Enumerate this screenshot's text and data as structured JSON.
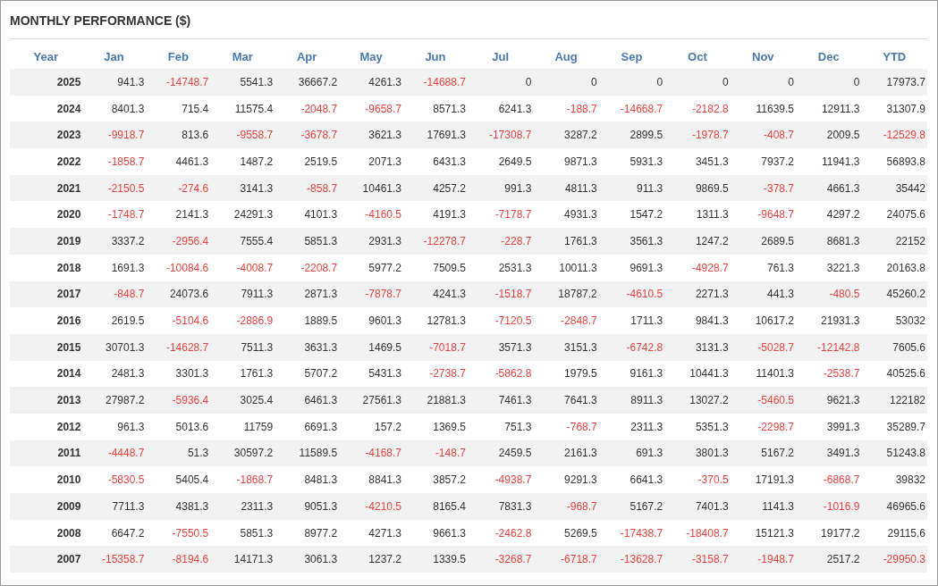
{
  "title": "MONTHLY PERFORMANCE ($)",
  "columns": [
    "Year",
    "Jan",
    "Feb",
    "Mar",
    "Apr",
    "May",
    "Jun",
    "Jul",
    "Aug",
    "Sep",
    "Oct",
    "Nov",
    "Dec",
    "YTD"
  ],
  "rows": [
    {
      "year": "2025",
      "cells": [
        {
          "text": "941.3",
          "negative": false
        },
        {
          "text": "-14748.7",
          "negative": true
        },
        {
          "text": "5541.3",
          "negative": false
        },
        {
          "text": "36667.2",
          "negative": false
        },
        {
          "text": "4261.3",
          "negative": false
        },
        {
          "text": "-14688.7",
          "negative": true
        },
        {
          "text": "0",
          "negative": false
        },
        {
          "text": "0",
          "negative": false
        },
        {
          "text": "0",
          "negative": false
        },
        {
          "text": "0",
          "negative": false
        },
        {
          "text": "0",
          "negative": false
        },
        {
          "text": "0",
          "negative": false
        },
        {
          "text": "17973.7",
          "negative": false
        }
      ]
    },
    {
      "year": "2024",
      "cells": [
        {
          "text": "8401.3",
          "negative": false
        },
        {
          "text": "715.4",
          "negative": false
        },
        {
          "text": "11575.4",
          "negative": false
        },
        {
          "text": "-2048.7",
          "negative": true
        },
        {
          "text": "-9658.7",
          "negative": true
        },
        {
          "text": "8571.3",
          "negative": false
        },
        {
          "text": "6241.3",
          "negative": false
        },
        {
          "text": "-188.7",
          "negative": true
        },
        {
          "text": "-14668.7",
          "negative": true
        },
        {
          "text": "-2182.8",
          "negative": true
        },
        {
          "text": "11639.5",
          "negative": false
        },
        {
          "text": "12911.3",
          "negative": false
        },
        {
          "text": "31307.9",
          "negative": false
        }
      ]
    },
    {
      "year": "2023",
      "cells": [
        {
          "text": "-9918.7",
          "negative": true
        },
        {
          "text": "813.6",
          "negative": false
        },
        {
          "text": "-9558.7",
          "negative": true
        },
        {
          "text": "-3678.7",
          "negative": true
        },
        {
          "text": "3621.3",
          "negative": false
        },
        {
          "text": "17691.3",
          "negative": false
        },
        {
          "text": "-17308.7",
          "negative": true
        },
        {
          "text": "3287.2",
          "negative": false
        },
        {
          "text": "2899.5",
          "negative": false
        },
        {
          "text": "-1978.7",
          "negative": true
        },
        {
          "text": "-408.7",
          "negative": true
        },
        {
          "text": "2009.5",
          "negative": false
        },
        {
          "text": "-12529.8",
          "negative": true
        }
      ]
    },
    {
      "year": "2022",
      "cells": [
        {
          "text": "-1858.7",
          "negative": true
        },
        {
          "text": "4461.3",
          "negative": false
        },
        {
          "text": "1487.2",
          "negative": false
        },
        {
          "text": "2519.5",
          "negative": false
        },
        {
          "text": "2071.3",
          "negative": false
        },
        {
          "text": "6431.3",
          "negative": false
        },
        {
          "text": "2649.5",
          "negative": false
        },
        {
          "text": "9871.3",
          "negative": false
        },
        {
          "text": "5931.3",
          "negative": false
        },
        {
          "text": "3451.3",
          "negative": false
        },
        {
          "text": "7937.2",
          "negative": false
        },
        {
          "text": "11941.3",
          "negative": false
        },
        {
          "text": "56893.8",
          "negative": false
        }
      ]
    },
    {
      "year": "2021",
      "cells": [
        {
          "text": "-2150.5",
          "negative": true
        },
        {
          "text": "-274.6",
          "negative": true
        },
        {
          "text": "3141.3",
          "negative": false
        },
        {
          "text": "-858.7",
          "negative": true
        },
        {
          "text": "10461.3",
          "negative": false
        },
        {
          "text": "4257.2",
          "negative": false
        },
        {
          "text": "991.3",
          "negative": false
        },
        {
          "text": "4811.3",
          "negative": false
        },
        {
          "text": "911.3",
          "negative": false
        },
        {
          "text": "9869.5",
          "negative": false
        },
        {
          "text": "-378.7",
          "negative": true
        },
        {
          "text": "4661.3",
          "negative": false
        },
        {
          "text": "35442",
          "negative": false
        }
      ]
    },
    {
      "year": "2020",
      "cells": [
        {
          "text": "-1748.7",
          "negative": true
        },
        {
          "text": "2141.3",
          "negative": false
        },
        {
          "text": "24291.3",
          "negative": false
        },
        {
          "text": "4101.3",
          "negative": false
        },
        {
          "text": "-4160.5",
          "negative": true
        },
        {
          "text": "4191.3",
          "negative": false
        },
        {
          "text": "-7178.7",
          "negative": true
        },
        {
          "text": "4931.3",
          "negative": false
        },
        {
          "text": "1547.2",
          "negative": false
        },
        {
          "text": "1311.3",
          "negative": false
        },
        {
          "text": "-9648.7",
          "negative": true
        },
        {
          "text": "4297.2",
          "negative": false
        },
        {
          "text": "24075.6",
          "negative": false
        }
      ]
    },
    {
      "year": "2019",
      "cells": [
        {
          "text": "3337.2",
          "negative": false
        },
        {
          "text": "-2956.4",
          "negative": true
        },
        {
          "text": "7555.4",
          "negative": false
        },
        {
          "text": "5851.3",
          "negative": false
        },
        {
          "text": "2931.3",
          "negative": false
        },
        {
          "text": "-12278.7",
          "negative": true
        },
        {
          "text": "-228.7",
          "negative": true
        },
        {
          "text": "1761.3",
          "negative": false
        },
        {
          "text": "3561.3",
          "negative": false
        },
        {
          "text": "1247.2",
          "negative": false
        },
        {
          "text": "2689.5",
          "negative": false
        },
        {
          "text": "8681.3",
          "negative": false
        },
        {
          "text": "22152",
          "negative": false
        }
      ]
    },
    {
      "year": "2018",
      "cells": [
        {
          "text": "1691.3",
          "negative": false
        },
        {
          "text": "-10084.6",
          "negative": true
        },
        {
          "text": "-4008.7",
          "negative": true
        },
        {
          "text": "-2208.7",
          "negative": true
        },
        {
          "text": "5977.2",
          "negative": false
        },
        {
          "text": "7509.5",
          "negative": false
        },
        {
          "text": "2531.3",
          "negative": false
        },
        {
          "text": "10011.3",
          "negative": false
        },
        {
          "text": "9691.3",
          "negative": false
        },
        {
          "text": "-4928.7",
          "negative": true
        },
        {
          "text": "761.3",
          "negative": false
        },
        {
          "text": "3221.3",
          "negative": false
        },
        {
          "text": "20163.8",
          "negative": false
        }
      ]
    },
    {
      "year": "2017",
      "cells": [
        {
          "text": "-848.7",
          "negative": true
        },
        {
          "text": "24073.6",
          "negative": false
        },
        {
          "text": "7911.3",
          "negative": false
        },
        {
          "text": "2871.3",
          "negative": false
        },
        {
          "text": "-7878.7",
          "negative": true
        },
        {
          "text": "4241.3",
          "negative": false
        },
        {
          "text": "-1518.7",
          "negative": true
        },
        {
          "text": "18787.2",
          "negative": false
        },
        {
          "text": "-4610.5",
          "negative": true
        },
        {
          "text": "2271.3",
          "negative": false
        },
        {
          "text": "441.3",
          "negative": false
        },
        {
          "text": "-480.5",
          "negative": true
        },
        {
          "text": "45260.2",
          "negative": false
        }
      ]
    },
    {
      "year": "2016",
      "cells": [
        {
          "text": "2619.5",
          "negative": false
        },
        {
          "text": "-5104.6",
          "negative": true
        },
        {
          "text": "-2886.9",
          "negative": true
        },
        {
          "text": "1889.5",
          "negative": false
        },
        {
          "text": "9601.3",
          "negative": false
        },
        {
          "text": "12781.3",
          "negative": false
        },
        {
          "text": "-7120.5",
          "negative": true
        },
        {
          "text": "-2848.7",
          "negative": true
        },
        {
          "text": "1711.3",
          "negative": false
        },
        {
          "text": "9841.3",
          "negative": false
        },
        {
          "text": "10617.2",
          "negative": false
        },
        {
          "text": "21931.3",
          "negative": false
        },
        {
          "text": "53032",
          "negative": false
        }
      ]
    },
    {
      "year": "2015",
      "cells": [
        {
          "text": "30701.3",
          "negative": false
        },
        {
          "text": "-14628.7",
          "negative": true
        },
        {
          "text": "7511.3",
          "negative": false
        },
        {
          "text": "3631.3",
          "negative": false
        },
        {
          "text": "1469.5",
          "negative": false
        },
        {
          "text": "-7018.7",
          "negative": true
        },
        {
          "text": "3571.3",
          "negative": false
        },
        {
          "text": "3151.3",
          "negative": false
        },
        {
          "text": "-6742.8",
          "negative": true
        },
        {
          "text": "3131.3",
          "negative": false
        },
        {
          "text": "-5028.7",
          "negative": true
        },
        {
          "text": "-12142.8",
          "negative": true
        },
        {
          "text": "7605.6",
          "negative": false
        }
      ]
    },
    {
      "year": "2014",
      "cells": [
        {
          "text": "2481.3",
          "negative": false
        },
        {
          "text": "3301.3",
          "negative": false
        },
        {
          "text": "1761.3",
          "negative": false
        },
        {
          "text": "5707.2",
          "negative": false
        },
        {
          "text": "5431.3",
          "negative": false
        },
        {
          "text": "-2738.7",
          "negative": true
        },
        {
          "text": "-5862.8",
          "negative": true
        },
        {
          "text": "1979.5",
          "negative": false
        },
        {
          "text": "9161.3",
          "negative": false
        },
        {
          "text": "10441.3",
          "negative": false
        },
        {
          "text": "11401.3",
          "negative": false
        },
        {
          "text": "-2538.7",
          "negative": true
        },
        {
          "text": "40525.6",
          "negative": false
        }
      ]
    },
    {
      "year": "2013",
      "cells": [
        {
          "text": "27987.2",
          "negative": false
        },
        {
          "text": "-5936.4",
          "negative": true
        },
        {
          "text": "3025.4",
          "negative": false
        },
        {
          "text": "6461.3",
          "negative": false
        },
        {
          "text": "27561.3",
          "negative": false
        },
        {
          "text": "21881.3",
          "negative": false
        },
        {
          "text": "7461.3",
          "negative": false
        },
        {
          "text": "7641.3",
          "negative": false
        },
        {
          "text": "8911.3",
          "negative": false
        },
        {
          "text": "13027.2",
          "negative": false
        },
        {
          "text": "-5460.5",
          "negative": true
        },
        {
          "text": "9621.3",
          "negative": false
        },
        {
          "text": "122182",
          "negative": false
        }
      ]
    },
    {
      "year": "2012",
      "cells": [
        {
          "text": "961.3",
          "negative": false
        },
        {
          "text": "5013.6",
          "negative": false
        },
        {
          "text": "11759",
          "negative": false
        },
        {
          "text": "6691.3",
          "negative": false
        },
        {
          "text": "157.2",
          "negative": false
        },
        {
          "text": "1369.5",
          "negative": false
        },
        {
          "text": "751.3",
          "negative": false
        },
        {
          "text": "-768.7",
          "negative": true
        },
        {
          "text": "2311.3",
          "negative": false
        },
        {
          "text": "5351.3",
          "negative": false
        },
        {
          "text": "-2298.7",
          "negative": true
        },
        {
          "text": "3991.3",
          "negative": false
        },
        {
          "text": "35289.7",
          "negative": false
        }
      ]
    },
    {
      "year": "2011",
      "cells": [
        {
          "text": "-4448.7",
          "negative": true
        },
        {
          "text": "51.3",
          "negative": false
        },
        {
          "text": "30597.2",
          "negative": false
        },
        {
          "text": "11589.5",
          "negative": false
        },
        {
          "text": "-4168.7",
          "negative": true
        },
        {
          "text": "-148.7",
          "negative": true
        },
        {
          "text": "2459.5",
          "negative": false
        },
        {
          "text": "2161.3",
          "negative": false
        },
        {
          "text": "691.3",
          "negative": false
        },
        {
          "text": "3801.3",
          "negative": false
        },
        {
          "text": "5167.2",
          "negative": false
        },
        {
          "text": "3491.3",
          "negative": false
        },
        {
          "text": "51243.8",
          "negative": false
        }
      ]
    },
    {
      "year": "2010",
      "cells": [
        {
          "text": "-5830.5",
          "negative": true
        },
        {
          "text": "5405.4",
          "negative": false
        },
        {
          "text": "-1868.7",
          "negative": true
        },
        {
          "text": "8481.3",
          "negative": false
        },
        {
          "text": "8841.3",
          "negative": false
        },
        {
          "text": "3857.2",
          "negative": false
        },
        {
          "text": "-4938.7",
          "negative": true
        },
        {
          "text": "9291.3",
          "negative": false
        },
        {
          "text": "6641.3",
          "negative": false
        },
        {
          "text": "-370.5",
          "negative": true
        },
        {
          "text": "17191.3",
          "negative": false
        },
        {
          "text": "-6868.7",
          "negative": true
        },
        {
          "text": "39832",
          "negative": false
        }
      ]
    },
    {
      "year": "2009",
      "cells": [
        {
          "text": "7711.3",
          "negative": false
        },
        {
          "text": "4381.3",
          "negative": false
        },
        {
          "text": "2311.3",
          "negative": false
        },
        {
          "text": "9051.3",
          "negative": false
        },
        {
          "text": "-4210.5",
          "negative": true
        },
        {
          "text": "8165.4",
          "negative": false
        },
        {
          "text": "7831.3",
          "negative": false
        },
        {
          "text": "-968.7",
          "negative": true
        },
        {
          "text": "5167.2",
          "negative": false
        },
        {
          "text": "7401.3",
          "negative": false
        },
        {
          "text": "1141.3",
          "negative": false
        },
        {
          "text": "-1016.9",
          "negative": true
        },
        {
          "text": "46965.6",
          "negative": false
        }
      ]
    },
    {
      "year": "2008",
      "cells": [
        {
          "text": "6647.2",
          "negative": false
        },
        {
          "text": "-7550.5",
          "negative": true
        },
        {
          "text": "5851.3",
          "negative": false
        },
        {
          "text": "8977.2",
          "negative": false
        },
        {
          "text": "4271.3",
          "negative": false
        },
        {
          "text": "9661.3",
          "negative": false
        },
        {
          "text": "-2462.8",
          "negative": true
        },
        {
          "text": "5269.5",
          "negative": false
        },
        {
          "text": "-17438.7",
          "negative": true
        },
        {
          "text": "-18408.7",
          "negative": true
        },
        {
          "text": "15121.3",
          "negative": false
        },
        {
          "text": "19177.2",
          "negative": false
        },
        {
          "text": "29115.6",
          "negative": false
        }
      ]
    },
    {
      "year": "2007",
      "cells": [
        {
          "text": "-15358.7",
          "negative": true
        },
        {
          "text": "-8194.6",
          "negative": true
        },
        {
          "text": "14171.3",
          "negative": false
        },
        {
          "text": "3061.3",
          "negative": false
        },
        {
          "text": "1237.2",
          "negative": false
        },
        {
          "text": "1339.5",
          "negative": false
        },
        {
          "text": "-3268.7",
          "negative": true
        },
        {
          "text": "-6718.7",
          "negative": true
        },
        {
          "text": "-13628.7",
          "negative": true
        },
        {
          "text": "-3158.7",
          "negative": true
        },
        {
          "text": "-1948.7",
          "negative": true
        },
        {
          "text": "2517.2",
          "negative": false
        },
        {
          "text": "-29950.3",
          "negative": true
        }
      ]
    }
  ]
}
